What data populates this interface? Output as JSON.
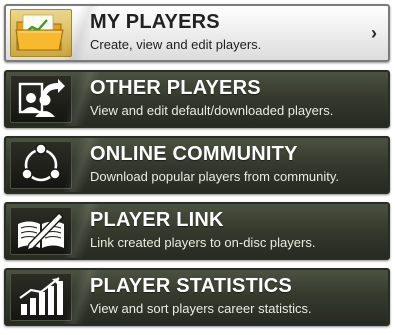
{
  "menu": {
    "items": [
      {
        "title": "MY PLAYERS",
        "subtitle": "Create, view and edit players.",
        "icon": "folder-chart-icon",
        "selected": true
      },
      {
        "title": "OTHER PLAYERS",
        "subtitle": "View and edit default/downloaded players.",
        "icon": "players-arrow-icon",
        "selected": false
      },
      {
        "title": "ONLINE COMMUNITY",
        "subtitle": "Download popular players from community.",
        "icon": "community-circle-icon",
        "selected": false
      },
      {
        "title": "PLAYER LINK",
        "subtitle": "Link created players to on-disc players.",
        "icon": "book-pen-icon",
        "selected": false
      },
      {
        "title": "PLAYER STATISTICS",
        "subtitle": "View and sort players career statistics.",
        "icon": "bar-chart-icon",
        "selected": false
      }
    ],
    "selected_chevron": "›"
  },
  "colors": {
    "item_dark": "#363b2e",
    "item_selected": "#f1f1f1",
    "selected_icon_bg": "#cba640",
    "text_light": "#ffffff",
    "text_dark": "#222222"
  }
}
